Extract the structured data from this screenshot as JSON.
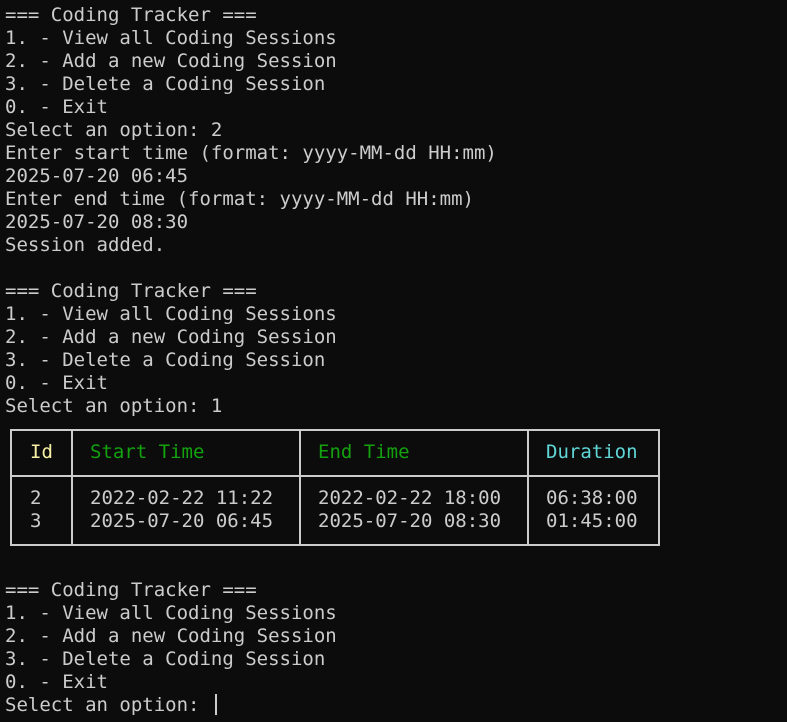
{
  "menu_blocks": [
    {
      "title": "=== Coding Tracker ===",
      "options": [
        "1. - View all Coding Sessions",
        "2. - Add a new Coding Session",
        "3. - Delete a Coding Session",
        "0. - Exit"
      ],
      "prompt": "Select an option: 2"
    },
    {
      "title": "=== Coding Tracker ===",
      "options": [
        "1. - View all Coding Sessions",
        "2. - Add a new Coding Session",
        "3. - Delete a Coding Session",
        "0. - Exit"
      ],
      "prompt": "Select an option: 1"
    },
    {
      "title": "=== Coding Tracker ===",
      "options": [
        "1. - View all Coding Sessions",
        "2. - Add a new Coding Session",
        "3. - Delete a Coding Session",
        "0. - Exit"
      ],
      "prompt": "Select an option: "
    }
  ],
  "add_session": {
    "start_prompt": "Enter start time (format: yyyy-MM-dd HH:mm)",
    "start_value": "2025-07-20 06:45",
    "end_prompt": "Enter end time (format: yyyy-MM-dd HH:mm)",
    "end_value": "2025-07-20 08:30",
    "result": "Session added."
  },
  "sessions_table": {
    "columns": [
      "Id",
      "Start Time",
      "End Time",
      "Duration"
    ],
    "rows": [
      [
        "2",
        "2022-02-22 11:22",
        "2022-02-22 18:00",
        "06:38:00"
      ],
      [
        "3",
        "2025-07-20 06:45",
        "2025-07-20 08:30",
        "01:45:00"
      ]
    ]
  },
  "colors": {
    "background": "#0c0c0c",
    "text": "#cccccc",
    "header_id": "#f9f1a5",
    "header_time": "#13a10e",
    "header_duration": "#61d6d6"
  }
}
